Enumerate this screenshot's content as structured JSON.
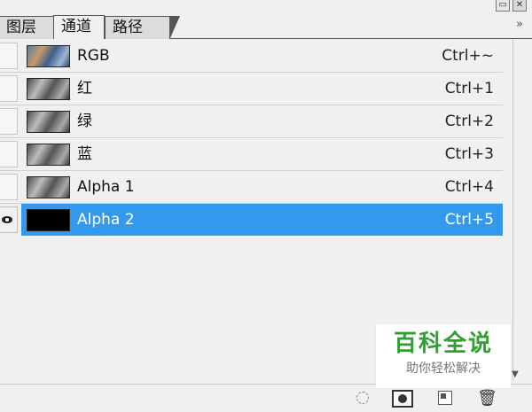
{
  "window": {
    "minimize_glyph": "▭",
    "close_glyph": "✕"
  },
  "tabs": [
    {
      "label": "图层"
    },
    {
      "label": "通道"
    },
    {
      "label": "路径"
    }
  ],
  "panel_menu_glyph": "»",
  "channels": [
    {
      "name": "RGB",
      "shortcut": "Ctrl+~",
      "thumb": "rgb",
      "visible": false,
      "selected": false
    },
    {
      "name": "红",
      "shortcut": "Ctrl+1",
      "thumb": "gray",
      "visible": false,
      "selected": false
    },
    {
      "name": "绿",
      "shortcut": "Ctrl+2",
      "thumb": "gray",
      "visible": false,
      "selected": false
    },
    {
      "name": "蓝",
      "shortcut": "Ctrl+3",
      "thumb": "gray",
      "visible": false,
      "selected": false
    },
    {
      "name": "Alpha 1",
      "shortcut": "Ctrl+4",
      "thumb": "gray",
      "visible": false,
      "selected": false
    },
    {
      "name": "Alpha 2",
      "shortcut": "Ctrl+5",
      "thumb": "black",
      "visible": true,
      "selected": true
    }
  ],
  "scroll_down_glyph": "▼",
  "toolbar": {
    "icons": [
      "selection-circle-icon",
      "mask-icon",
      "new-channel-icon",
      "trash-icon"
    ],
    "trash_glyph": "🗑"
  },
  "watermark": {
    "title": "百科全说",
    "subtitle": "助你轻松解决"
  },
  "colors": {
    "selection": "#3399ee",
    "watermark_green": "#2fa12f"
  }
}
